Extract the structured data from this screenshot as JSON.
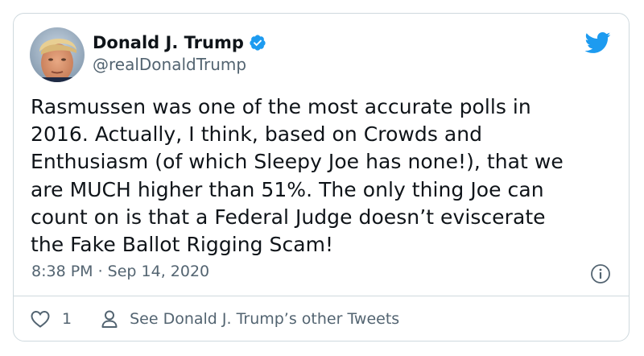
{
  "tweet": {
    "display_name": "Donald J. Trump",
    "handle": "@realDonaldTrump",
    "text": "Rasmussen was one of the most accurate polls in\n2016. Actually, I think, based on Crowds and\nEnthusiasm (of which Sleepy Joe has none!), that we\nare MUCH higher than 51%. The only thing Joe can\ncount on is that a Federal Judge doesn’t eviscerate\nthe Fake Ballot Rigging Scam!",
    "timestamp": "8:38 PM · Sep 14, 2020",
    "like_count": "1",
    "other_tweets_label": "See Donald J. Trump’s other Tweets"
  },
  "icons": {
    "brand": "twitter-bird-icon",
    "verified": "verified-badge-icon",
    "info": "info-icon",
    "like": "heart-icon",
    "profile": "person-icon"
  },
  "colors": {
    "brand_blue": "#1d9bf0",
    "text_primary": "#0f1419",
    "text_secondary": "#536471",
    "border": "#cfd9de"
  }
}
